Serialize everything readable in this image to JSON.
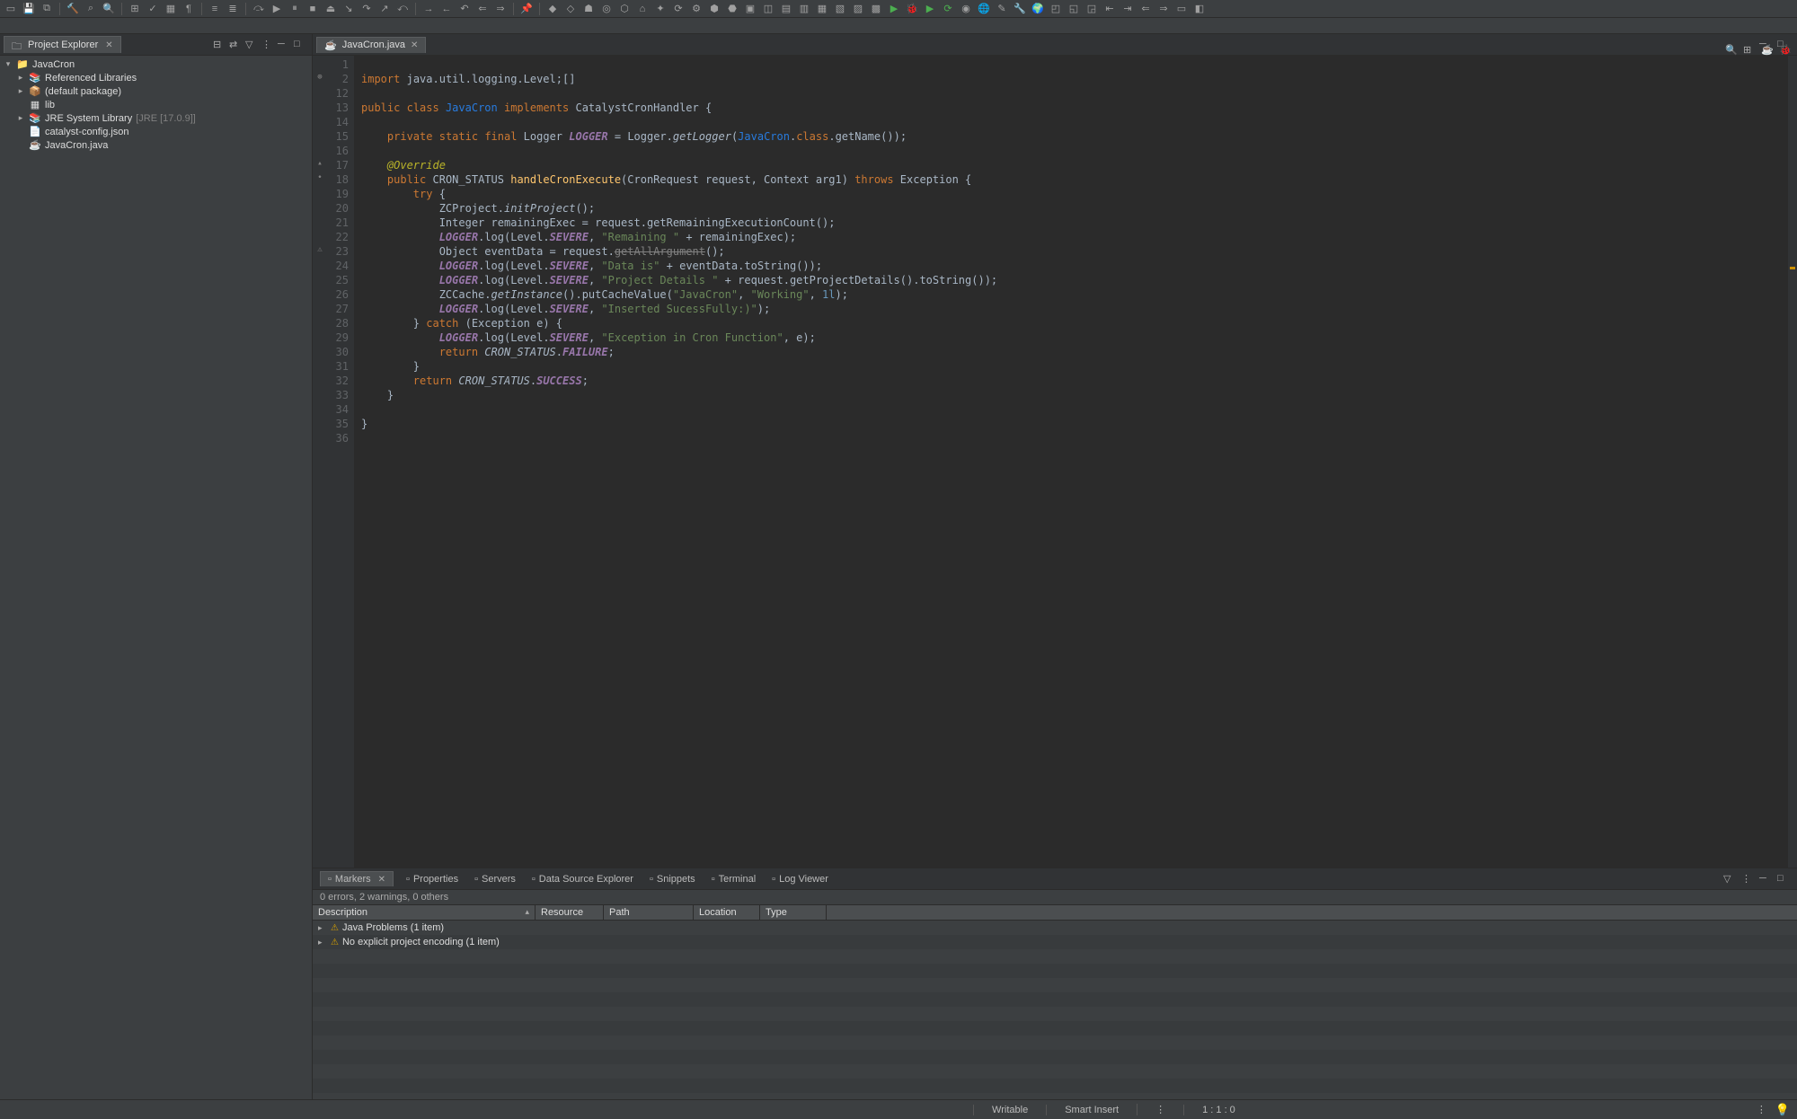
{
  "sidebar": {
    "title": "Project Explorer",
    "tree": [
      {
        "label": "JavaCron",
        "indent": 0,
        "icon": "📁",
        "expander": "▾"
      },
      {
        "label": "Referenced Libraries",
        "indent": 1,
        "icon": "📚",
        "expander": "▸"
      },
      {
        "label": "(default package)",
        "indent": 1,
        "icon": "📦",
        "expander": "▸"
      },
      {
        "label": "lib",
        "indent": 1,
        "icon": "▦",
        "expander": ""
      },
      {
        "label": "JRE System Library",
        "suffix": "[JRE [17.0.9]]",
        "indent": 1,
        "icon": "📚",
        "expander": "▸"
      },
      {
        "label": "catalyst-config.json",
        "indent": 1,
        "icon": "📄",
        "expander": ""
      },
      {
        "label": "JavaCron.java",
        "indent": 1,
        "icon": "☕",
        "expander": ""
      }
    ]
  },
  "editor": {
    "tab": {
      "label": "JavaCron.java",
      "icon": "☕"
    },
    "line_start": 1,
    "line_end": 36,
    "gutter_marks": {
      "2": "⊕",
      "17": "▴",
      "18": "•",
      "23": "⚠"
    },
    "code_lines": [
      {
        "n": 1,
        "html": ""
      },
      {
        "n": 2,
        "html": "<span class='kw'>import</span> <span class='import-path'>java.util.logging.Level</span>;<span class='type'>[]</span>"
      },
      {
        "n": 12,
        "html": ""
      },
      {
        "n": 13,
        "html": "<span class='kw'>public</span> <span class='kw'>class</span> <span class='linked-type'>JavaCron</span> <span class='kw'>implements</span> <span class='classname'>CatalystCronHandler</span> {"
      },
      {
        "n": 14,
        "html": ""
      },
      {
        "n": 15,
        "html": "    <span class='kw'>private</span> <span class='kw'>static</span> <span class='kw'>final</span> <span class='classname'>Logger</span> <span class='static-field'>LOGGER</span> = <span class='classname'>Logger</span>.<span class='static-call ital'>getLogger</span>(<span class='linked-type'>JavaCron</span>.<span class='kw'>class</span>.<span class='call'>getName</span>());"
      },
      {
        "n": 16,
        "html": ""
      },
      {
        "n": 17,
        "html": "    <span class='ann'>@Override</span>"
      },
      {
        "n": 18,
        "html": "    <span class='kw'>public</span> <span class='classname'>CRON_STATUS</span> <span class='method-decl'>handleCronExecute</span>(<span class='classname'>CronRequest</span> <span class='param'>request</span>, <span class='classname'>Context</span> <span class='param'>arg1</span>) <span class='kw'>throws</span> <span class='classname'>Exception</span> {"
      },
      {
        "n": 19,
        "html": "        <span class='kw'>try</span> {"
      },
      {
        "n": 20,
        "html": "            <span class='classname'>ZCProject</span>.<span class='static-call ital'>initProject</span>();"
      },
      {
        "n": 21,
        "html": "            <span class='classname'>Integer</span> <span class='param'>remainingExec</span> = <span class='param'>request</span>.<span class='call'>getRemainingExecutionCount</span>();"
      },
      {
        "n": 22,
        "html": "            <span class='static-field'>LOGGER</span>.<span class='call'>log</span>(<span class='classname'>Level</span>.<span class='enum-const'>SEVERE</span>, <span class='str'>\"Remaining \"</span> + <span class='param'>remainingExec</span>);"
      },
      {
        "n": 23,
        "html": "            <span class='classname'>Object</span> <span class='param'>eventData</span> = <span class='param'>request</span>.<span class='deprecated'>getAllArgument</span>();"
      },
      {
        "n": 24,
        "html": "            <span class='static-field'>LOGGER</span>.<span class='call'>log</span>(<span class='classname'>Level</span>.<span class='enum-const'>SEVERE</span>, <span class='str'>\"Data is\"</span> + <span class='param'>eventData</span>.<span class='call'>toString</span>());"
      },
      {
        "n": 25,
        "html": "            <span class='static-field'>LOGGER</span>.<span class='call'>log</span>(<span class='classname'>Level</span>.<span class='enum-const'>SEVERE</span>, <span class='str'>\"Project Details \"</span> + <span class='param'>request</span>.<span class='call'>getProjectDetails</span>().<span class='call'>toString</span>());"
      },
      {
        "n": 26,
        "html": "            <span class='classname'>ZCCache</span>.<span class='static-call ital'>getInstance</span>().<span class='call'>putCacheValue</span>(<span class='str'>\"JavaCron\"</span>, <span class='str'>\"Working\"</span>, <span class='num'>1l</span>);"
      },
      {
        "n": 27,
        "html": "            <span class='static-field'>LOGGER</span>.<span class='call'>log</span>(<span class='classname'>Level</span>.<span class='enum-const'>SEVERE</span>, <span class='str'>\"Inserted SucessFully:)\"</span>);"
      },
      {
        "n": 28,
        "html": "        } <span class='kw'>catch</span> (<span class='classname'>Exception</span> <span class='param'>e</span>) {"
      },
      {
        "n": 29,
        "html": "            <span class='static-field'>LOGGER</span>.<span class='call'>log</span>(<span class='classname'>Level</span>.<span class='enum-const'>SEVERE</span>, <span class='str'>\"Exception in Cron Function\"</span>, <span class='param'>e</span>);"
      },
      {
        "n": 30,
        "html": "            <span class='kw'>return</span> <span class='classname ital'>CRON_STATUS</span>.<span class='enum-const'>FAILURE</span>;"
      },
      {
        "n": 31,
        "html": "        }"
      },
      {
        "n": 32,
        "html": "        <span class='kw'>return</span> <span class='classname ital'>CRON_STATUS</span>.<span class='enum-const'>SUCCESS</span>;"
      },
      {
        "n": 33,
        "html": "    }"
      },
      {
        "n": 34,
        "html": ""
      },
      {
        "n": 35,
        "html": "}"
      },
      {
        "n": 36,
        "html": ""
      }
    ]
  },
  "bottom": {
    "tabs": [
      {
        "label": "Markers",
        "active": true
      },
      {
        "label": "Properties"
      },
      {
        "label": "Servers"
      },
      {
        "label": "Data Source Explorer"
      },
      {
        "label": "Snippets"
      },
      {
        "label": "Terminal"
      },
      {
        "label": "Log Viewer"
      }
    ],
    "summary": "0 errors, 2 warnings, 0 others",
    "columns": [
      "Description",
      "Resource",
      "Path",
      "Location",
      "Type"
    ],
    "rows": [
      {
        "label": "Java Problems (1 item)"
      },
      {
        "label": "No explicit project encoding (1 item)"
      }
    ]
  },
  "statusbar": {
    "writable": "Writable",
    "insert_mode": "Smart Insert",
    "position": "1 : 1 : 0"
  }
}
